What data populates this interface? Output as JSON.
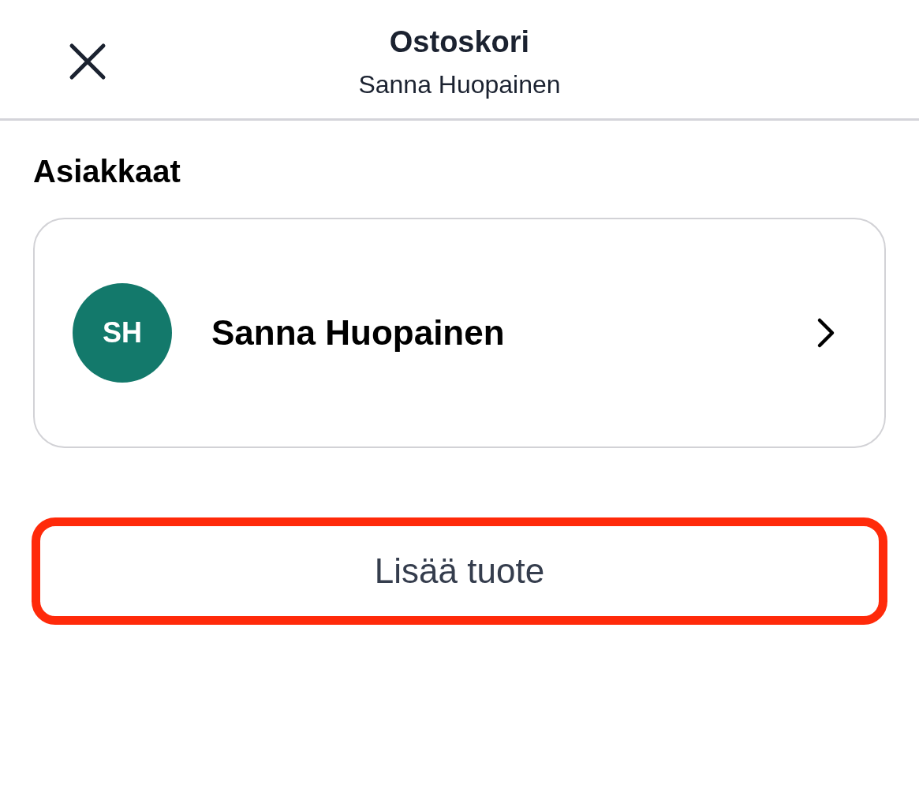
{
  "header": {
    "title": "Ostoskori",
    "subtitle": "Sanna Huopainen"
  },
  "section_title": "Asiakkaat",
  "customers": [
    {
      "initials": "SH",
      "name": "Sanna Huopainen",
      "color": "#13796b"
    }
  ],
  "add_button": {
    "label": "Lisää tuote"
  }
}
